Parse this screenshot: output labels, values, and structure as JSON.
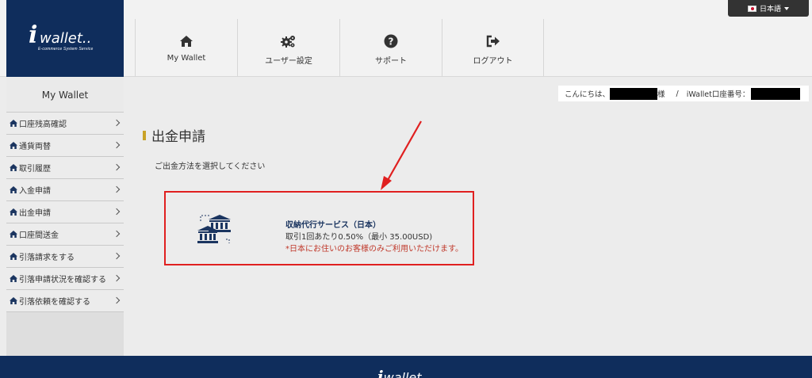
{
  "logo": {
    "brand_i": "i",
    "brand_word": "wallet..",
    "tagline": "E-commerce System Service"
  },
  "language": {
    "label": "日本語"
  },
  "nav": [
    {
      "label": "My Wallet",
      "icon": "home-icon"
    },
    {
      "label": "ユーザー設定",
      "icon": "cogs-icon"
    },
    {
      "label": "サポート",
      "icon": "question-circle-icon"
    },
    {
      "label": "ログアウト",
      "icon": "sign-out-icon"
    }
  ],
  "sidebar": {
    "title": "My Wallet",
    "items": [
      {
        "label": "口座残高確認"
      },
      {
        "label": "通貨両替"
      },
      {
        "label": "取引履歴"
      },
      {
        "label": "入金申請"
      },
      {
        "label": "出金申請"
      },
      {
        "label": "口座間送金"
      },
      {
        "label": "引落請求をする"
      },
      {
        "label": "引落申請状況を確認する"
      },
      {
        "label": "引落依頼を確認する"
      }
    ]
  },
  "greeting": {
    "prefix": "こんにちは、",
    "suffix": "様",
    "separator": "/",
    "account_label": "iWallet口座番号："
  },
  "main": {
    "title": "出金申請",
    "instruction": "ご出金方法を選択してください",
    "option": {
      "title": "収納代行サービス（日本）",
      "fee": "取引1回あたり0.50%（最小 35.00USD)",
      "note": "*日本にお住いのお客様のみご利用いただけます。",
      "icon": "bank-transfer-icon"
    }
  },
  "footer": {
    "logo_i": "i",
    "logo_word": "wallet"
  },
  "colors": {
    "navy": "#0f2d5c",
    "highlight": "#e02020",
    "note_red": "#c0392b",
    "title_accent": "#c9a227"
  }
}
